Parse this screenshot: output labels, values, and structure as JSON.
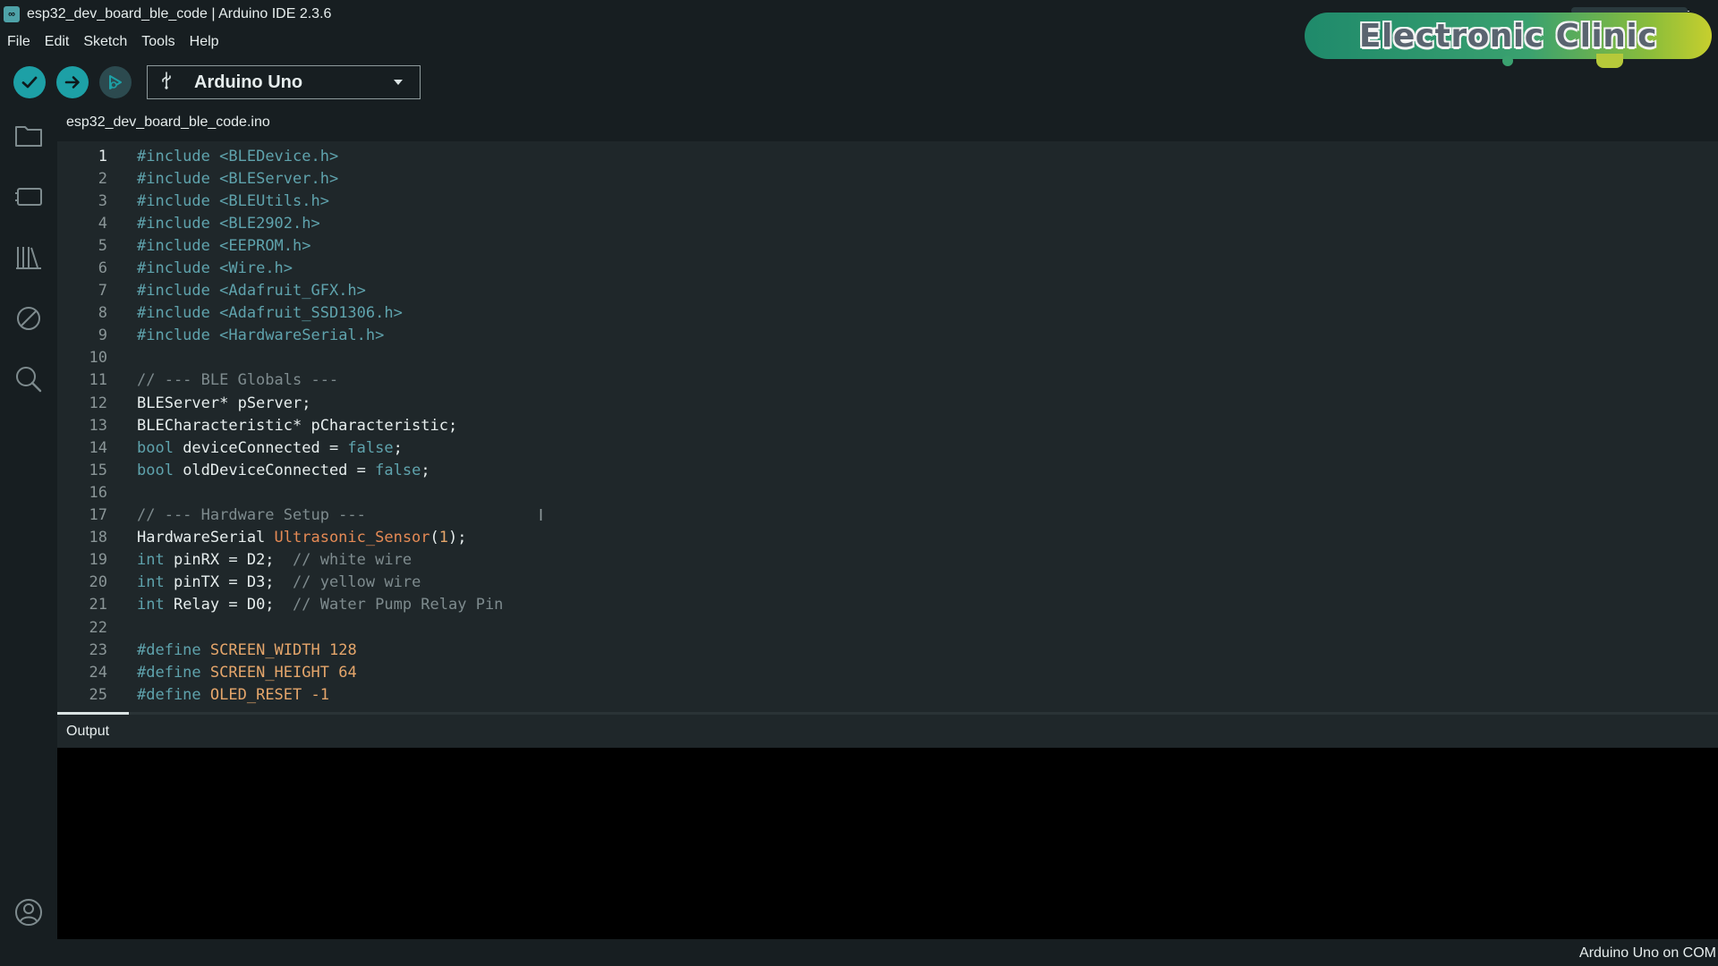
{
  "window": {
    "title": "esp32_dev_board_ble_code | Arduino IDE 2.3.6",
    "minimize_glyph": "—"
  },
  "watermark": {
    "text": "Electronic Clinic"
  },
  "menu": [
    "File",
    "Edit",
    "Sketch",
    "Tools",
    "Help"
  ],
  "toolbar": {
    "board_name": "Arduino Uno"
  },
  "editor": {
    "file_tab": "esp32_dev_board_ble_code.ino",
    "lines": [
      {
        "n": "1",
        "parts": [
          [
            "kw",
            "#include"
          ],
          [
            "",
            " "
          ],
          [
            "kw",
            "<BLEDevice.h>"
          ]
        ]
      },
      {
        "n": "2",
        "parts": [
          [
            "kw",
            "#include"
          ],
          [
            "",
            " "
          ],
          [
            "kw",
            "<BLEServer.h>"
          ]
        ]
      },
      {
        "n": "3",
        "parts": [
          [
            "kw",
            "#include"
          ],
          [
            "",
            " "
          ],
          [
            "kw",
            "<BLEUtils.h>"
          ]
        ]
      },
      {
        "n": "4",
        "parts": [
          [
            "kw",
            "#include"
          ],
          [
            "",
            " "
          ],
          [
            "kw",
            "<BLE2902.h>"
          ]
        ]
      },
      {
        "n": "5",
        "parts": [
          [
            "kw",
            "#include"
          ],
          [
            "",
            " "
          ],
          [
            "kw",
            "<EEPROM.h>"
          ]
        ]
      },
      {
        "n": "6",
        "parts": [
          [
            "kw",
            "#include"
          ],
          [
            "",
            " "
          ],
          [
            "kw",
            "<Wire.h>"
          ]
        ]
      },
      {
        "n": "7",
        "parts": [
          [
            "kw",
            "#include"
          ],
          [
            "",
            " "
          ],
          [
            "kw",
            "<Adafruit_GFX.h>"
          ]
        ]
      },
      {
        "n": "8",
        "parts": [
          [
            "kw",
            "#include"
          ],
          [
            "",
            " "
          ],
          [
            "kw",
            "<Adafruit_SSD1306.h>"
          ]
        ]
      },
      {
        "n": "9",
        "parts": [
          [
            "kw",
            "#include"
          ],
          [
            "",
            " "
          ],
          [
            "kw",
            "<HardwareSerial.h>"
          ]
        ]
      },
      {
        "n": "10",
        "parts": []
      },
      {
        "n": "11",
        "parts": [
          [
            "cm",
            "// --- BLE Globals ---"
          ]
        ]
      },
      {
        "n": "12",
        "parts": [
          [
            "",
            "BLEServer* pServer;"
          ]
        ]
      },
      {
        "n": "13",
        "parts": [
          [
            "",
            "BLECharacteristic* pCharacteristic;"
          ]
        ]
      },
      {
        "n": "14",
        "parts": [
          [
            "kw",
            "bool"
          ],
          [
            "",
            " deviceConnected = "
          ],
          [
            "kw",
            "false"
          ],
          [
            "",
            ";"
          ]
        ]
      },
      {
        "n": "15",
        "parts": [
          [
            "kw",
            "bool"
          ],
          [
            "",
            " oldDeviceConnected = "
          ],
          [
            "kw",
            "false"
          ],
          [
            "",
            ";"
          ]
        ]
      },
      {
        "n": "16",
        "parts": []
      },
      {
        "n": "17",
        "parts": [
          [
            "cm",
            "// --- Hardware Setup ---"
          ]
        ]
      },
      {
        "n": "18",
        "parts": [
          [
            "",
            "HardwareSerial "
          ],
          [
            "fn",
            "Ultrasonic_Sensor"
          ],
          [
            "",
            "("
          ],
          [
            "nm",
            "1"
          ],
          [
            "",
            ");"
          ]
        ]
      },
      {
        "n": "19",
        "parts": [
          [
            "kw",
            "int"
          ],
          [
            "",
            " pinRX = D2;  "
          ],
          [
            "cm",
            "// white wire"
          ]
        ]
      },
      {
        "n": "20",
        "parts": [
          [
            "kw",
            "int"
          ],
          [
            "",
            " pinTX = D3;  "
          ],
          [
            "cm",
            "// yellow wire"
          ]
        ]
      },
      {
        "n": "21",
        "parts": [
          [
            "kw",
            "int"
          ],
          [
            "",
            " Relay = D0;  "
          ],
          [
            "cm",
            "// Water Pump Relay Pin"
          ]
        ]
      },
      {
        "n": "22",
        "parts": []
      },
      {
        "n": "23",
        "parts": [
          [
            "kw",
            "#define"
          ],
          [
            "",
            " "
          ],
          [
            "df",
            "SCREEN_WIDTH"
          ],
          [
            "",
            " "
          ],
          [
            "nm",
            "128"
          ]
        ]
      },
      {
        "n": "24",
        "parts": [
          [
            "kw",
            "#define"
          ],
          [
            "",
            " "
          ],
          [
            "df",
            "SCREEN_HEIGHT"
          ],
          [
            "",
            " "
          ],
          [
            "nm",
            "64"
          ]
        ]
      },
      {
        "n": "25",
        "parts": [
          [
            "kw",
            "#define"
          ],
          [
            "",
            " "
          ],
          [
            "df",
            "OLED_RESET"
          ],
          [
            "",
            " "
          ],
          [
            "nm",
            "-1"
          ]
        ]
      }
    ]
  },
  "output": {
    "label": "Output"
  },
  "status": {
    "text": "Arduino Uno on COM"
  }
}
